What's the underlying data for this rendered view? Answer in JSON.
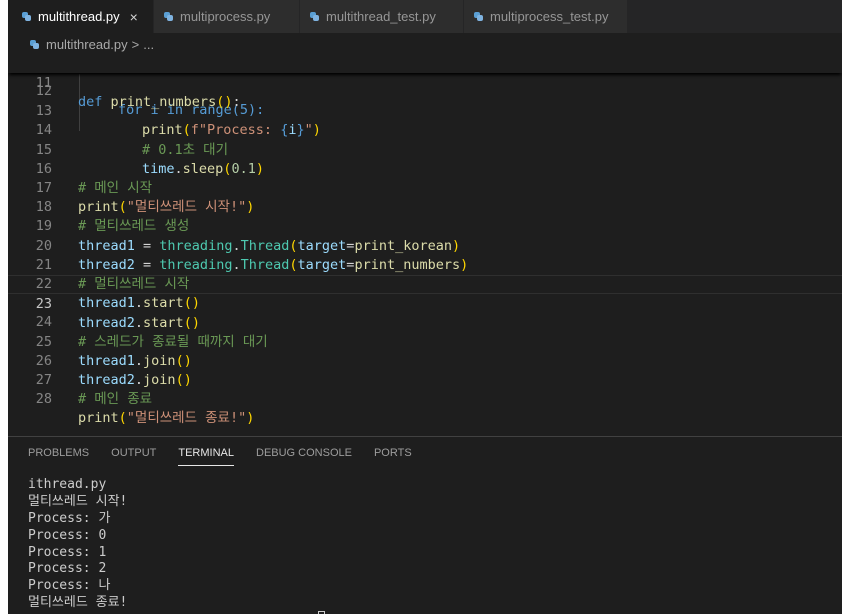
{
  "tabs": [
    {
      "label": "multithread.py",
      "active": true,
      "close": "×"
    },
    {
      "label": "multiprocess.py",
      "active": false
    },
    {
      "label": "multithread_test.py",
      "active": false
    },
    {
      "label": "multiprocess_test.py",
      "active": false
    }
  ],
  "breadcrumb": {
    "file": "multithread.py",
    "separator": ">",
    "rest": "..."
  },
  "editor": {
    "sticky_line": {
      "number": "11",
      "keyword": "def",
      "name": "print_numbers",
      "paren": "()",
      "colon": ":"
    },
    "partial_line": {
      "number": "12",
      "text": "for i in range(5):"
    },
    "lines": [
      {
        "number": "13",
        "t1": "print",
        "t2": "(",
        "t3": "f\"Process: ",
        "t4": "{",
        "t5": "i",
        "t6": "}",
        "t7": "\"",
        "t8": ")"
      },
      {
        "number": "14",
        "comment": "# 0.1초 대기"
      },
      {
        "number": "15",
        "t1": "time",
        "t2": ".",
        "t3": "sleep",
        "t4": "(",
        "t5": "0.1",
        "t6": ")"
      },
      {
        "number": "16",
        "comment": "# 메인 시작"
      },
      {
        "number": "17",
        "t1": "print",
        "t2": "(",
        "t3": "\"멀티쓰레드 시작!\"",
        "t4": ")"
      },
      {
        "number": "18",
        "comment": "# 멀티쓰레드 생성"
      },
      {
        "number": "19",
        "t1": "thread1",
        "t2": " = ",
        "t3": "threading",
        "t4": ".",
        "t5": "Thread",
        "t6": "(",
        "t7": "target",
        "t8": "=",
        "t9": "print_korean",
        "t10": ")"
      },
      {
        "number": "20",
        "t1": "thread2",
        "t2": " = ",
        "t3": "threading",
        "t4": ".",
        "t5": "Thread",
        "t6": "(",
        "t7": "target",
        "t8": "=",
        "t9": "print_numbers",
        "t10": ")"
      },
      {
        "number": "21",
        "comment": "# 멀티쓰레드 시작"
      },
      {
        "number": "22",
        "t1": "thread1",
        "t2": ".",
        "t3": "start",
        "t4": "()"
      },
      {
        "number": "23",
        "t1": "thread2",
        "t2": ".",
        "t3": "start",
        "t4": "()"
      },
      {
        "number": "24",
        "comment": "# 스레드가 종료될 때까지 대기"
      },
      {
        "number": "25",
        "t1": "thread1",
        "t2": ".",
        "t3": "join",
        "t4": "()"
      },
      {
        "number": "26",
        "t1": "thread2",
        "t2": ".",
        "t3": "join",
        "t4": "()"
      },
      {
        "number": "27",
        "comment": "# 메인 종료"
      },
      {
        "number": "28",
        "t1": "print",
        "t2": "(",
        "t3": "\"멀티쓰레드 종료!\"",
        "t4": ")"
      }
    ]
  },
  "panel": {
    "tabs": [
      "PROBLEMS",
      "OUTPUT",
      "TERMINAL",
      "DEBUG CONSOLE",
      "PORTS"
    ],
    "active_tab": "TERMINAL",
    "terminal_lines": [
      "ithread.py",
      "멀티쓰레드 시작!",
      "Process: 가",
      "Process: 0",
      "Process: 1",
      "Process: 2",
      "Process: 나",
      "멀티쓰레드 종료!"
    ]
  },
  "colors": {
    "editor_bg": "#1e1e1e",
    "keyword": "#569cd6",
    "function": "#dcdcaa",
    "string": "#ce9178",
    "comment": "#6a9955",
    "variable": "#9cdcfe",
    "class": "#4ec9b0"
  }
}
